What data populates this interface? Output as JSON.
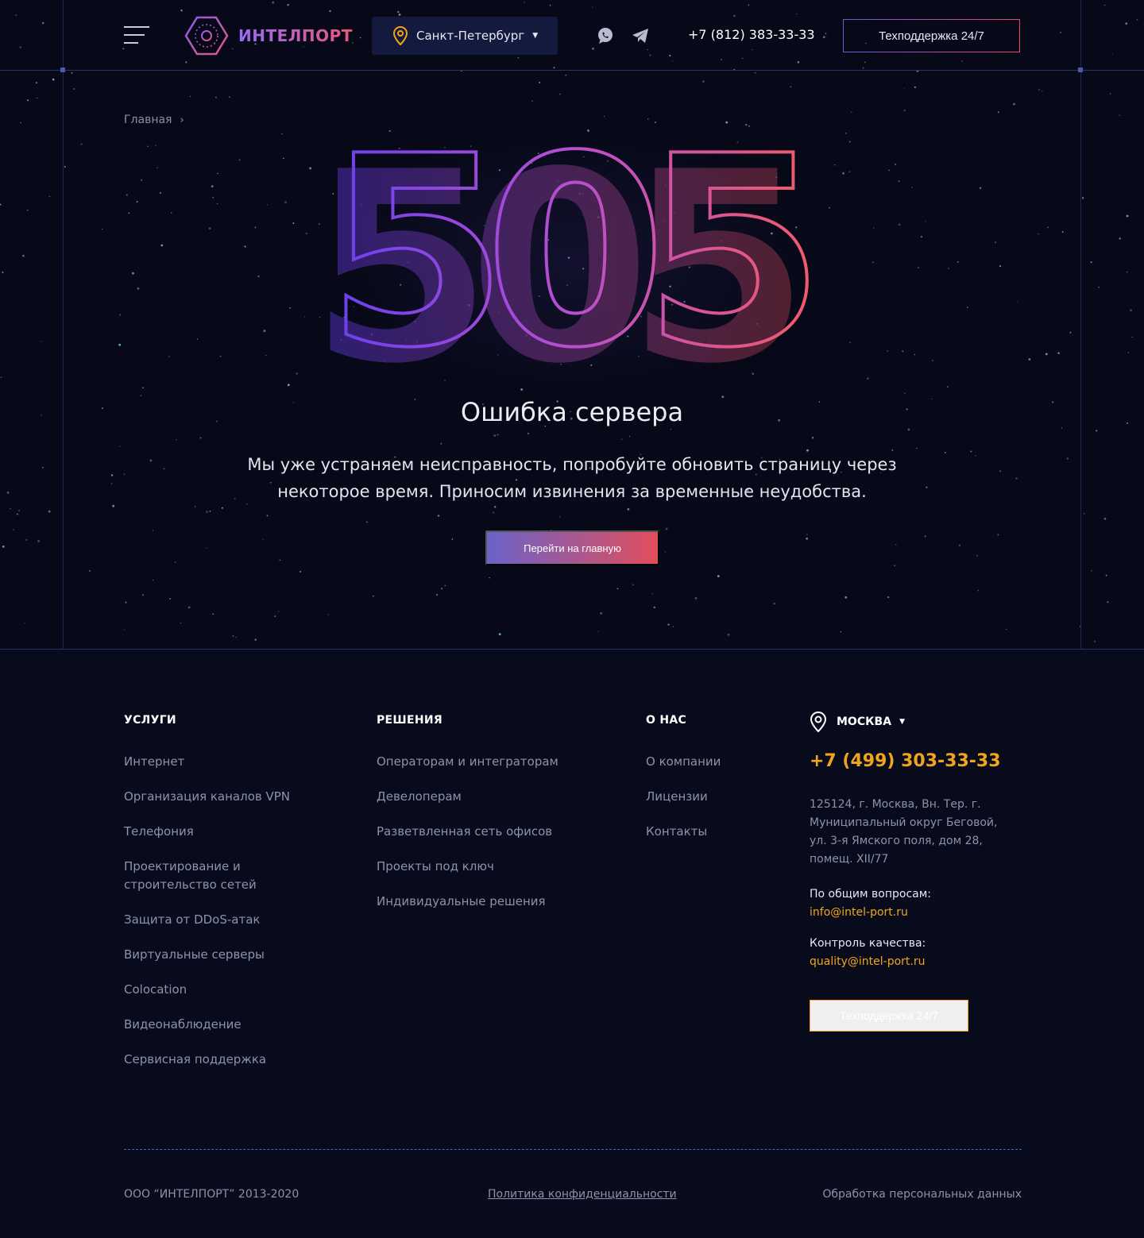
{
  "header": {
    "logo_text": "ИНТЕЛПОРТ",
    "city": "Санкт-Петербург",
    "phone": "+7 (812) 383-33-33",
    "support_label": "Техподдержка 24/7",
    "messengers": [
      "whatsapp-icon",
      "telegram-icon"
    ]
  },
  "breadcrumb": {
    "home": "Главная",
    "separator": "›"
  },
  "error": {
    "code": "505",
    "title": "Ошибка сервера",
    "message": "Мы уже устраняем неисправность, попробуйте обновить страницу через некоторое время. Приносим извинения за временные неудобства.",
    "button": "Перейти на главную"
  },
  "footer": {
    "services": {
      "title": "УСЛУГИ",
      "items": [
        "Интернет",
        "Организация каналов VPN",
        "Телефония",
        "Проектирование и строительство сетей",
        "Защита от DDoS-атак",
        "Виртуальные серверы",
        "Colocation",
        "Видеонаблюдение",
        "Сервисная поддержка"
      ]
    },
    "solutions": {
      "title": "РЕШЕНИЯ",
      "items": [
        "Операторам и интеграторам",
        "Девелоперам",
        "Разветвленная сеть офисов",
        "Проекты под ключ",
        "Индивидуальные решения"
      ]
    },
    "about": {
      "title": "О НАС",
      "items": [
        "О компании",
        "Лицензии",
        "Контакты"
      ]
    },
    "contacts": {
      "city": "МОСКВА",
      "phone": "+7 (499) 303-33-33",
      "address": "125124, г. Москва, Вн. Тер. г. Муниципальный округ Беговой, ул. 3-я Ямского поля, дом 28, помещ. XII/77",
      "general_label": "По общим вопросам:",
      "general_email": "info@intel-port.ru",
      "quality_label": "Контроль качества:",
      "quality_email": "quality@intel-port.ru",
      "support_label": "Техподдержка 24/7"
    },
    "copyright": "ООО “ИНТЕЛПОРТ” 2013-2020",
    "privacy": "Политика конфиденциальности",
    "personal_data": "Обработка персональных данных"
  },
  "colors": {
    "accent_orange": "#f2a51c",
    "gradient_start": "#6a5ad8",
    "gradient_end": "#e64a6a",
    "background": "#07091a"
  }
}
